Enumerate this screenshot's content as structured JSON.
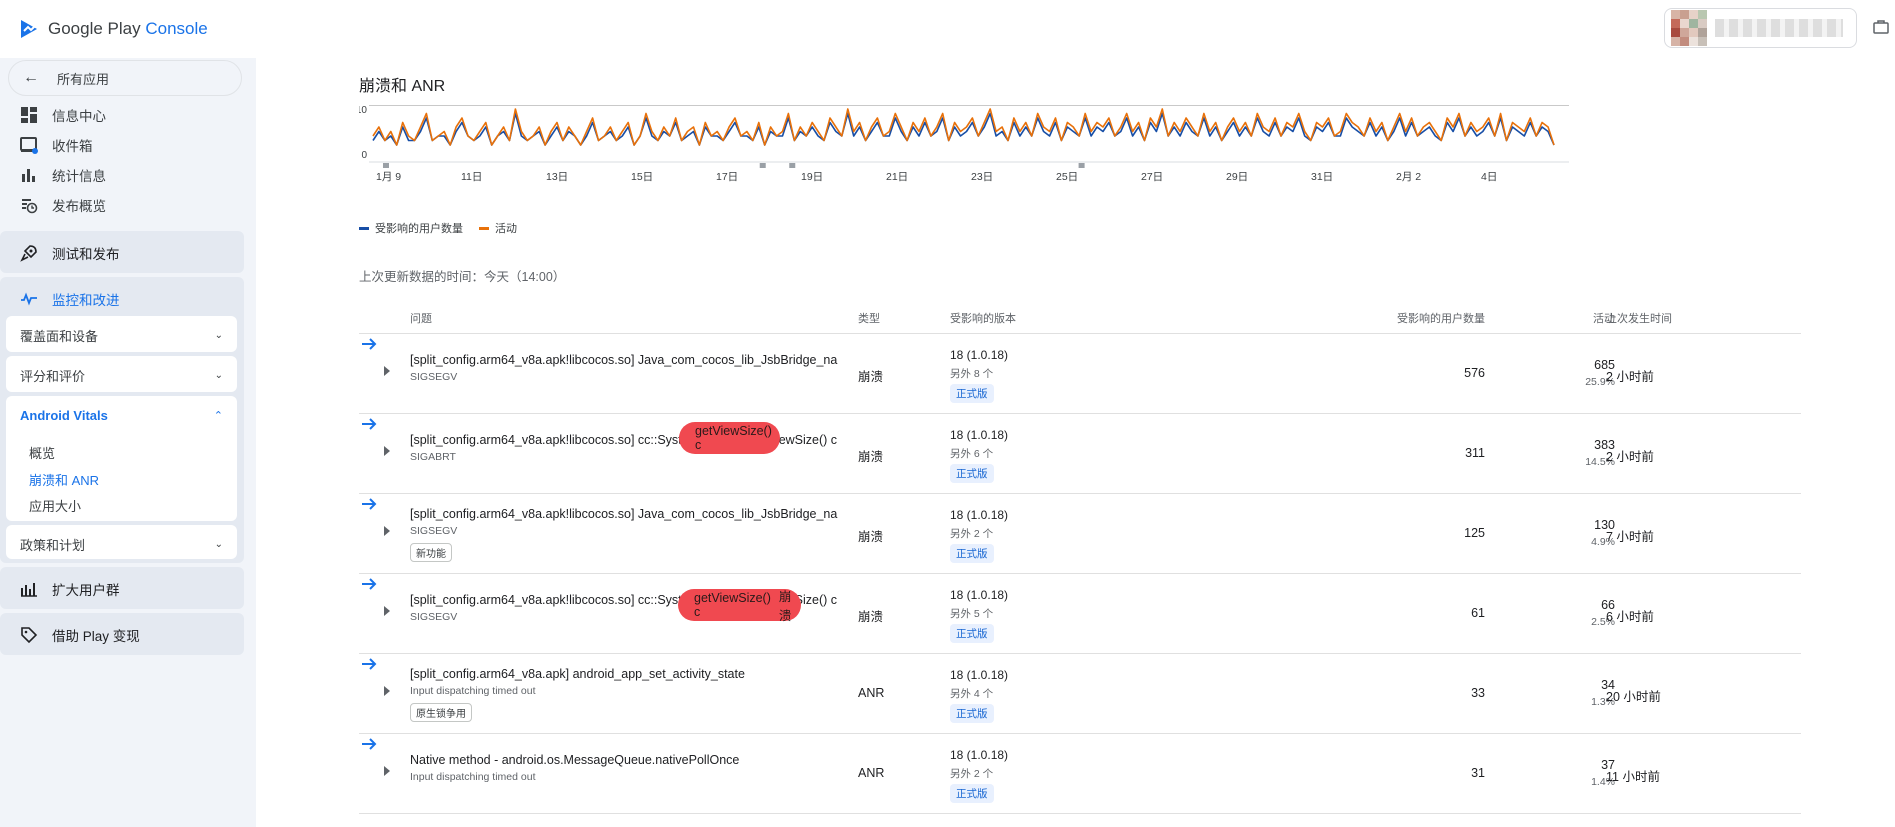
{
  "header": {
    "logo_text": "Google Play",
    "logo_console": "Console"
  },
  "sidebar": {
    "back_label": "所有应用",
    "nav_items": [
      {
        "label": "信息中心",
        "icon": "dashboard-icon"
      },
      {
        "label": "收件箱",
        "icon": "inbox-icon"
      },
      {
        "label": "统计信息",
        "icon": "bar-chart-icon"
      },
      {
        "label": "发布概览",
        "icon": "publish-overview-icon"
      }
    ],
    "test_release": "测试和发布",
    "monitor": "监控和改进",
    "cards": {
      "coverage": "覆盖面和设备",
      "ratings": "评分和评价",
      "vitals": "Android Vitals",
      "vitals_links": [
        "概览",
        "崩溃和 ANR",
        "应用大小"
      ],
      "policy": "政策和计划"
    },
    "grow": "扩大用户群",
    "monetize": "借助 Play 变现"
  },
  "main": {
    "title": "崩溃和 ANR",
    "updated": "上次更新数据的时间：今天（14:00）"
  },
  "chart_data": {
    "type": "line",
    "title": "",
    "x_ticks": [
      "1月 9",
      "11日",
      "13日",
      "15日",
      "17日",
      "19日",
      "21日",
      "23日",
      "25日",
      "27日",
      "29日",
      "31日",
      "2月 2",
      "4日"
    ],
    "y_ticks": [
      0,
      10
    ],
    "ylim": [
      0,
      10
    ],
    "series": [
      {
        "name": "受影响的用户数量",
        "color": "#174ea6"
      },
      {
        "name": "活动",
        "color": "#e8710a"
      }
    ],
    "activity_values": [
      4,
      6,
      3,
      5,
      2,
      7,
      4,
      3,
      6,
      9,
      3,
      4,
      5,
      2,
      6,
      8,
      4,
      3,
      5,
      7,
      2,
      4,
      6,
      3,
      10,
      5,
      3,
      4,
      6,
      2,
      5,
      7,
      3,
      6,
      4,
      2,
      5,
      8,
      3,
      4,
      6,
      3,
      5,
      7,
      2,
      4,
      9,
      5,
      3,
      6,
      4,
      8,
      3,
      5,
      6,
      2,
      7,
      4,
      5,
      3,
      6,
      8,
      4,
      5,
      3,
      7,
      2,
      6,
      4,
      5,
      9,
      3,
      6,
      4,
      7,
      5,
      3,
      8,
      6,
      4,
      10,
      5,
      7,
      3,
      6,
      8,
      4,
      5,
      9,
      6,
      3,
      7,
      5,
      8,
      4,
      6,
      9,
      3,
      7,
      5,
      6,
      8,
      4,
      7,
      10,
      5,
      6,
      3,
      8,
      5,
      7,
      4,
      9,
      6,
      5,
      8,
      3,
      7,
      6,
      4,
      9,
      5,
      7,
      6,
      8,
      4,
      6,
      9,
      5,
      7,
      3,
      8,
      6,
      10,
      4,
      7,
      5,
      8,
      6,
      4,
      9,
      5,
      7,
      3,
      6,
      8,
      5,
      7,
      4,
      9,
      6,
      5,
      8,
      4,
      7,
      6,
      9,
      5,
      3,
      7,
      6,
      8,
      4,
      5,
      9,
      7,
      6,
      4,
      8,
      5,
      7,
      3,
      6,
      9,
      5,
      8,
      4,
      6,
      7,
      5,
      3,
      8,
      6,
      9,
      4,
      7,
      5,
      6,
      8,
      4,
      9,
      3,
      7,
      6,
      5,
      8,
      4,
      7,
      6,
      2
    ],
    "users_values": [
      3,
      5,
      3,
      4,
      2,
      6,
      3,
      3,
      5,
      8,
      3,
      4,
      4,
      2,
      5,
      7,
      4,
      3,
      4,
      6,
      2,
      4,
      5,
      3,
      9,
      4,
      3,
      4,
      5,
      2,
      4,
      6,
      3,
      5,
      4,
      2,
      4,
      7,
      3,
      4,
      5,
      3,
      4,
      6,
      2,
      4,
      8,
      4,
      3,
      5,
      4,
      7,
      3,
      4,
      5,
      2,
      6,
      4,
      4,
      3,
      5,
      7,
      4,
      4,
      3,
      6,
      2,
      5,
      4,
      4,
      8,
      3,
      5,
      4,
      6,
      4,
      3,
      7,
      5,
      4,
      9,
      4,
      6,
      3,
      5,
      7,
      4,
      4,
      8,
      5,
      3,
      6,
      4,
      7,
      4,
      5,
      8,
      3,
      6,
      4,
      5,
      7,
      4,
      6,
      9,
      4,
      5,
      3,
      7,
      4,
      6,
      4,
      8,
      5,
      4,
      7,
      3,
      6,
      5,
      4,
      8,
      4,
      6,
      5,
      7,
      4,
      5,
      8,
      4,
      6,
      3,
      7,
      5,
      9,
      4,
      6,
      4,
      7,
      5,
      4,
      8,
      4,
      6,
      3,
      5,
      7,
      4,
      6,
      4,
      8,
      5,
      4,
      7,
      4,
      6,
      5,
      8,
      4,
      3,
      6,
      5,
      7,
      4,
      4,
      8,
      6,
      5,
      4,
      7,
      4,
      6,
      3,
      5,
      8,
      4,
      7,
      4,
      5,
      6,
      4,
      3,
      7,
      5,
      8,
      4,
      6,
      4,
      5,
      7,
      4,
      8,
      3,
      6,
      5,
      4,
      7,
      4,
      6,
      5,
      2
    ]
  },
  "table": {
    "headers": {
      "issue": "问题",
      "type": "类型",
      "version": "受影响的版本",
      "users": "受影响的用户数量",
      "events": "活动",
      "last": "上次发生时间"
    },
    "rows": [
      {
        "title": "[split_config.arm64_v8a.apk!libcocos.so] Java_com_cocos_lib_JsbBridge_na",
        "sub": "SIGSEGV",
        "tag": "",
        "type": "崩溃",
        "version": "18 (1.0.18)",
        "version_more": "另外 8 个",
        "badge": "正式版",
        "users": "576",
        "events": "685",
        "pct": "25.9%",
        "last": "2 小时前"
      },
      {
        "title": "[split_config.arm64_v8a.apk!libcocos.so] cc::SystemWindow::getViewSize() c",
        "sub": "SIGABRT",
        "tag": "",
        "type": "崩溃",
        "version": "18 (1.0.18)",
        "version_more": "另外 6 个",
        "badge": "正式版",
        "users": "311",
        "events": "383",
        "pct": "14.5%",
        "last": "2 小时前"
      },
      {
        "title": "[split_config.arm64_v8a.apk!libcocos.so] Java_com_cocos_lib_JsbBridge_na",
        "sub": "SIGSEGV",
        "tag": "新功能",
        "type": "崩溃",
        "version": "18 (1.0.18)",
        "version_more": "另外 2 个",
        "badge": "正式版",
        "users": "125",
        "events": "130",
        "pct": "4.9%",
        "last": "7 小时前"
      },
      {
        "title": "[split_config.arm64_v8a.apk!libcocos.so] cc::SystemWindow::getViewSize() c",
        "sub": "SIGSEGV",
        "tag": "",
        "type": "崩溃",
        "version": "18 (1.0.18)",
        "version_more": "另外 5 个",
        "badge": "正式版",
        "users": "61",
        "events": "66",
        "pct": "2.5%",
        "last": "6 小时前"
      },
      {
        "title": "[split_config.arm64_v8a.apk] android_app_set_activity_state",
        "sub": "Input dispatching timed out",
        "tag": "原生锁争用",
        "type": "ANR",
        "version": "18 (1.0.18)",
        "version_more": "另外 4 个",
        "badge": "正式版",
        "users": "33",
        "events": "34",
        "pct": "1.3%",
        "last": "20 小时前"
      },
      {
        "title": "Native method - android.os.MessageQueue.nativePollOnce",
        "sub": "Input dispatching timed out",
        "tag": "",
        "type": "ANR",
        "version": "18 (1.0.18)",
        "version_more": "另外 2 个",
        "badge": "正式版",
        "users": "31",
        "events": "37",
        "pct": "1.4%",
        "last": "11 小时前"
      }
    ]
  },
  "redactions": {
    "row2": "getViewSize() c",
    "row4": "getViewSize() c",
    "row4_type": "崩溃"
  },
  "colors": {
    "accent": "#1a73e8",
    "activity": "#e8710a",
    "users": "#174ea6",
    "redaction": "#f04950"
  }
}
